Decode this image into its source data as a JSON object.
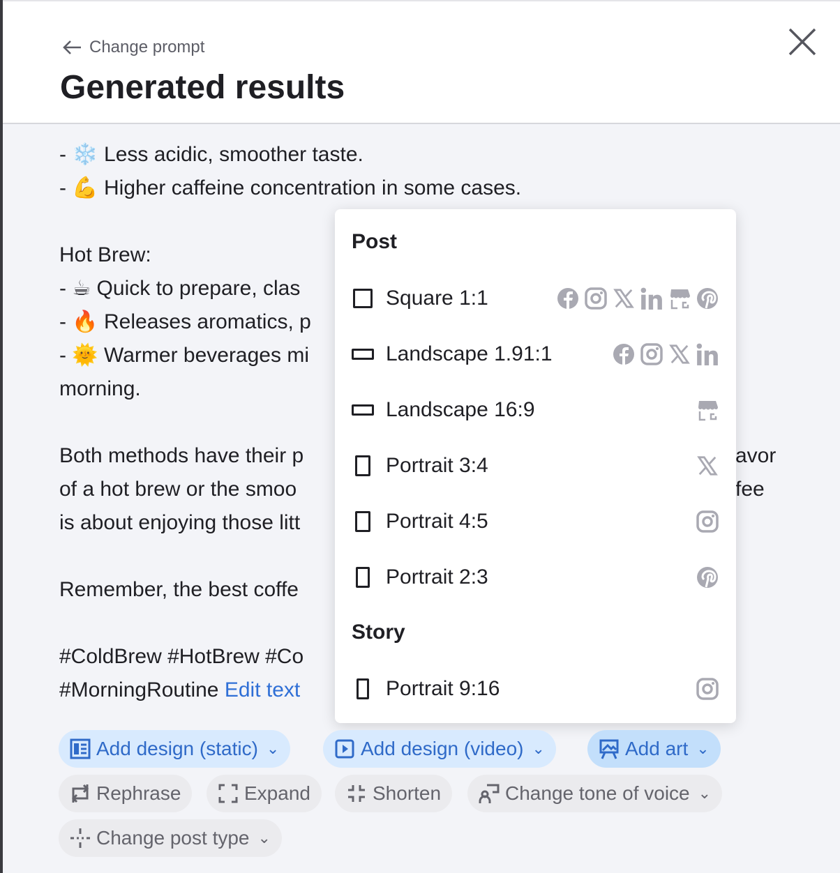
{
  "header": {
    "back_label": "Change prompt",
    "title": "Generated results"
  },
  "content": {
    "lines": [
      "- ❄️ Less acidic, smoother taste.",
      "- 💪 Higher caffeine concentration in some cases.",
      "Hot Brew:",
      "- ☕ Quick to prepare, clas",
      "- 🔥 Releases aromatics, p",
      "- 🌞 Warmer beverages mi",
      "morning.",
      "Both methods have their p",
      "of a hot brew or the smoo",
      "is about enjoying those litt",
      "Remember, the best coffe",
      "#ColdBrew #HotBrew #Co",
      "#MorningRoutine"
    ],
    "right_fragments": [
      "avor",
      "fee"
    ],
    "edit_link": "Edit text"
  },
  "popup": {
    "post_heading": "Post",
    "story_heading": "Story",
    "post_items": [
      {
        "label": "Square 1:1",
        "icons": [
          "facebook-icon",
          "instagram-icon",
          "x-icon",
          "linkedin-icon",
          "google-business-icon",
          "pinterest-icon"
        ]
      },
      {
        "label": "Landscape 1.91:1",
        "icons": [
          "facebook-icon",
          "instagram-icon",
          "x-icon",
          "linkedin-icon"
        ]
      },
      {
        "label": "Landscape 16:9",
        "icons": [
          "google-business-icon"
        ]
      },
      {
        "label": "Portrait 3:4",
        "icons": [
          "x-icon"
        ]
      },
      {
        "label": "Portrait 4:5",
        "icons": [
          "instagram-icon"
        ]
      },
      {
        "label": "Portrait 2:3",
        "icons": [
          "pinterest-icon"
        ]
      }
    ],
    "story_items": [
      {
        "label": "Portrait 9:16",
        "icons": [
          "instagram-icon"
        ]
      }
    ]
  },
  "actions": {
    "add_static": "Add design (static)",
    "add_video": "Add design (video)",
    "add_art": "Add art",
    "rephrase": "Rephrase",
    "expand": "Expand",
    "shorten": "Shorten",
    "tone": "Change tone of voice",
    "post_type": "Change post type"
  },
  "colors": {
    "accent": "#2f6ac8",
    "icon_grey": "#a9a9b2",
    "bg": "#f3f4f8"
  }
}
